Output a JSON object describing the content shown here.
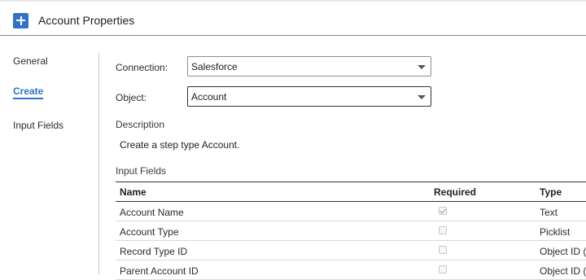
{
  "header": {
    "title": "Account Properties",
    "add_icon": "plus-icon"
  },
  "nav": {
    "items": [
      {
        "label": "General",
        "active": false
      },
      {
        "label": "Create",
        "active": true
      },
      {
        "label": "Input Fields",
        "active": false
      }
    ]
  },
  "form": {
    "connection": {
      "label": "Connection:",
      "value": "Salesforce"
    },
    "object": {
      "label": "Object:",
      "value": "Account"
    }
  },
  "description": {
    "title": "Description",
    "text": "Create a step type Account."
  },
  "input_fields": {
    "title": "Input Fields",
    "columns": [
      "Name",
      "Required",
      "Type"
    ],
    "rows": [
      {
        "name": "Account Name",
        "required": true,
        "type": "Text"
      },
      {
        "name": "Account Type",
        "required": false,
        "type": "Picklist"
      },
      {
        "name": "Record Type ID",
        "required": false,
        "type": "Object ID ("
      },
      {
        "name": "Parent Account ID",
        "required": false,
        "type": "Object ID ("
      }
    ]
  },
  "colors": {
    "accent": "#2f72c8"
  }
}
